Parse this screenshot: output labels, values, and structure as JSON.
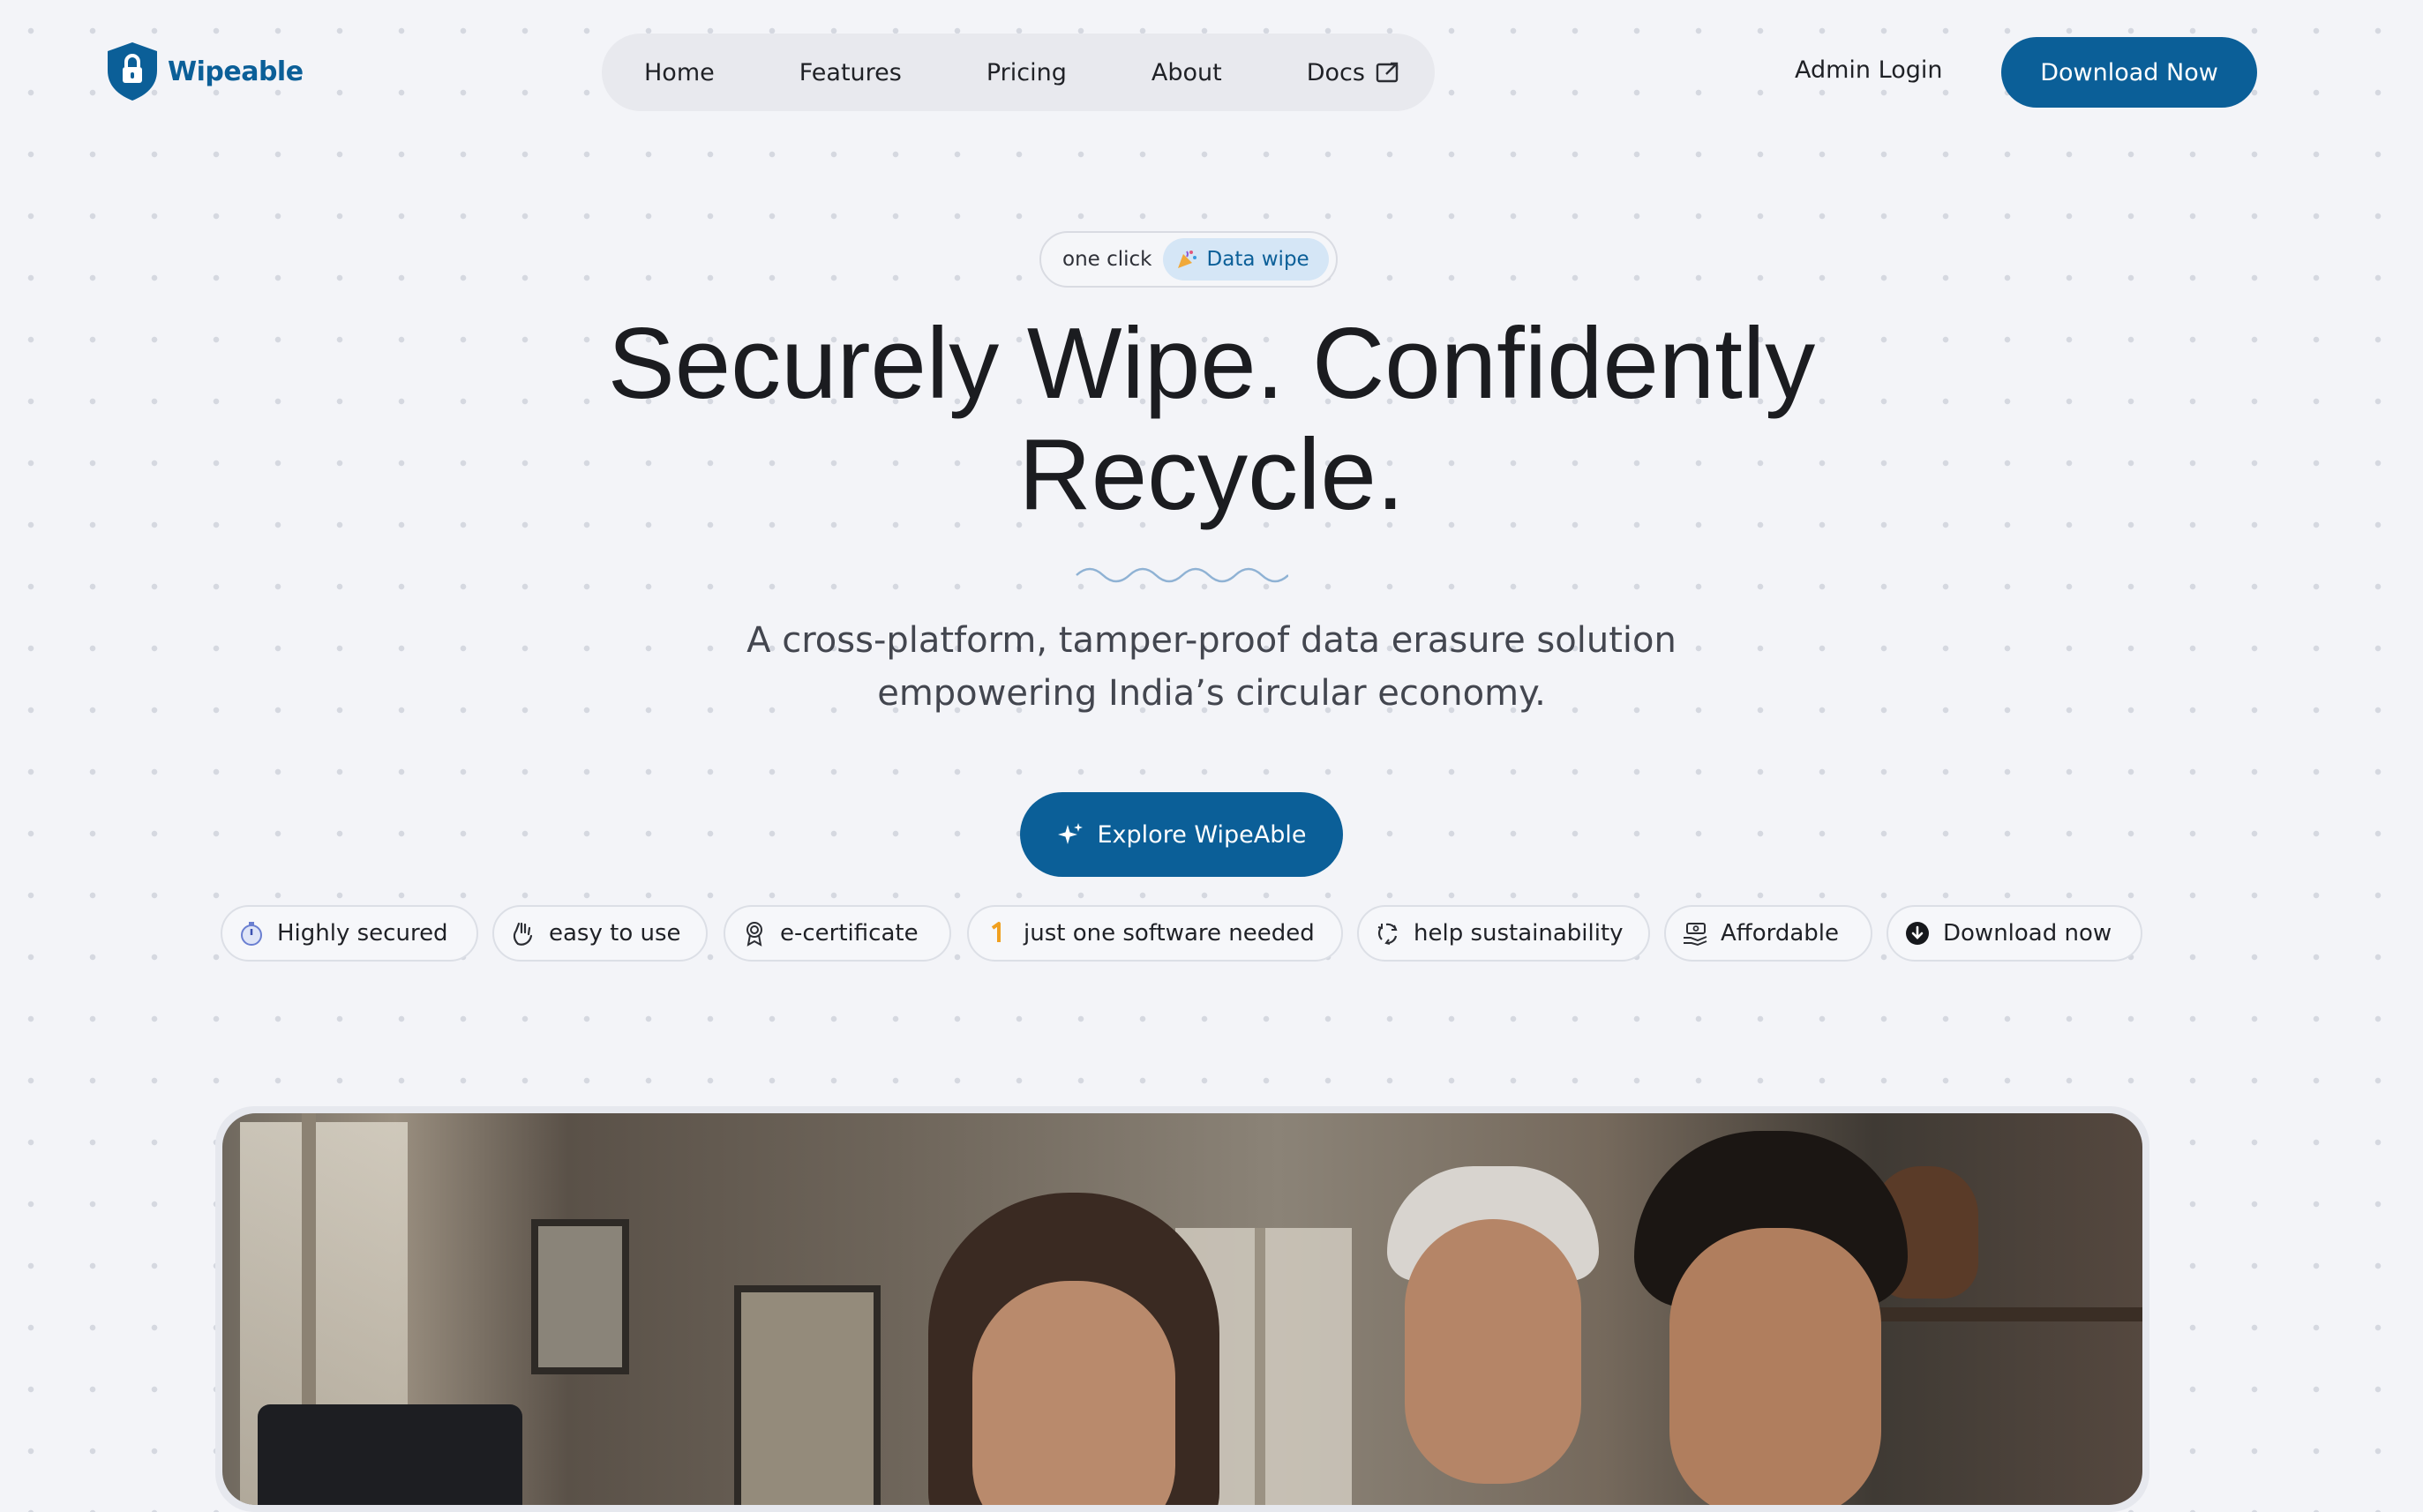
{
  "brand": {
    "name": "Wipeable",
    "accent_color": "#0b5f98"
  },
  "nav": {
    "items": [
      {
        "label": "Home"
      },
      {
        "label": "Features"
      },
      {
        "label": "Pricing"
      },
      {
        "label": "About"
      },
      {
        "label": "Docs",
        "icon": "external-link-icon"
      }
    ]
  },
  "header": {
    "admin_login": "Admin Login",
    "download_label": "Download Now"
  },
  "hero": {
    "badge_lead": "one click",
    "badge_chip": "Data wipe",
    "badge_icon": "party-popper-icon",
    "title_line1": "Securely Wipe. Confidently",
    "title_line2": "Recycle.",
    "subtitle_line1": "A cross-platform, tamper-proof data erasure solution",
    "subtitle_line2": "empowering India’s circular economy.",
    "cta_label": "Explore WipeAble",
    "cta_icon": "sparkles-icon"
  },
  "feature_pills": [
    {
      "label": "Highly secured",
      "icon": "stopwatch-icon"
    },
    {
      "label": "easy to use",
      "icon": "hand-wave-icon"
    },
    {
      "label": "e-certificate",
      "icon": "award-ribbon-icon"
    },
    {
      "label": "just one software needed",
      "icon": "number-one-icon"
    },
    {
      "label": "help sustainability",
      "icon": "recycle-icon"
    },
    {
      "label": "Affordable",
      "icon": "money-hand-icon"
    },
    {
      "label": "Download now",
      "icon": "download-circle-icon"
    }
  ],
  "hero_image": {
    "description_icon": "hero-photo"
  }
}
